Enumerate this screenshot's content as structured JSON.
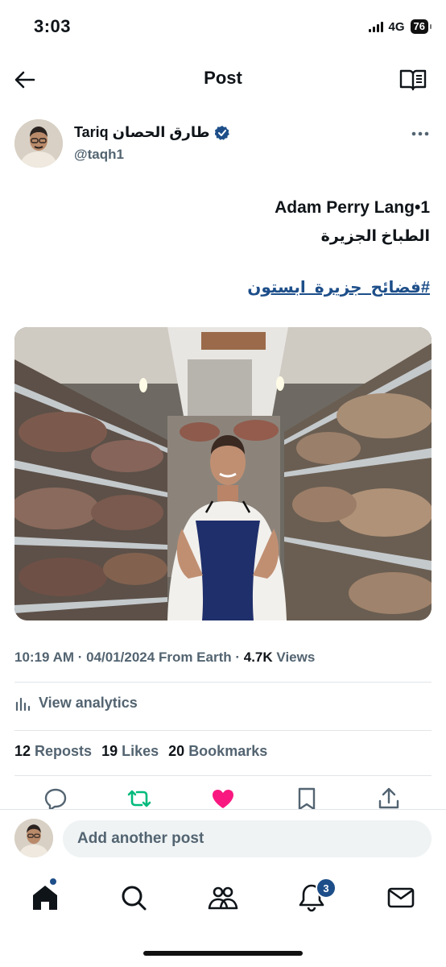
{
  "status_bar": {
    "time": "3:03",
    "network": "4G",
    "battery": "76"
  },
  "header": {
    "title": "Post"
  },
  "author": {
    "name": "Tariq طارق الحصان",
    "handle": "@taqh1"
  },
  "post": {
    "line1": "Adam Perry Lang•1",
    "line2": "الطباخ الجزيرة",
    "hashtag": "#فضائح_جزيرة_ابستون",
    "time": "10:19 AM",
    "date": "04/01/2024",
    "source": "From Earth",
    "views_count": "4.7K",
    "views_label": "Views",
    "analytics_label": "View analytics",
    "reposts_count": "12",
    "reposts_label": "Reposts",
    "likes_count": "19",
    "likes_label": "Likes",
    "bookmarks_count": "20",
    "bookmarks_label": "Bookmarks"
  },
  "reply": {
    "placeholder": "Add another post"
  },
  "tabs": {
    "notifications_badge": "3"
  },
  "colors": {
    "like": "#f91880",
    "repost": "#00ba7c",
    "link": "#1d4e89",
    "muted": "#536471"
  },
  "icons": [
    "back-arrow-icon",
    "reader-icon",
    "verified-icon",
    "more-icon",
    "reply-icon",
    "repost-icon",
    "like-icon",
    "bookmark-icon",
    "share-icon",
    "home-icon",
    "search-icon",
    "communities-icon",
    "notifications-icon",
    "messages-icon"
  ]
}
